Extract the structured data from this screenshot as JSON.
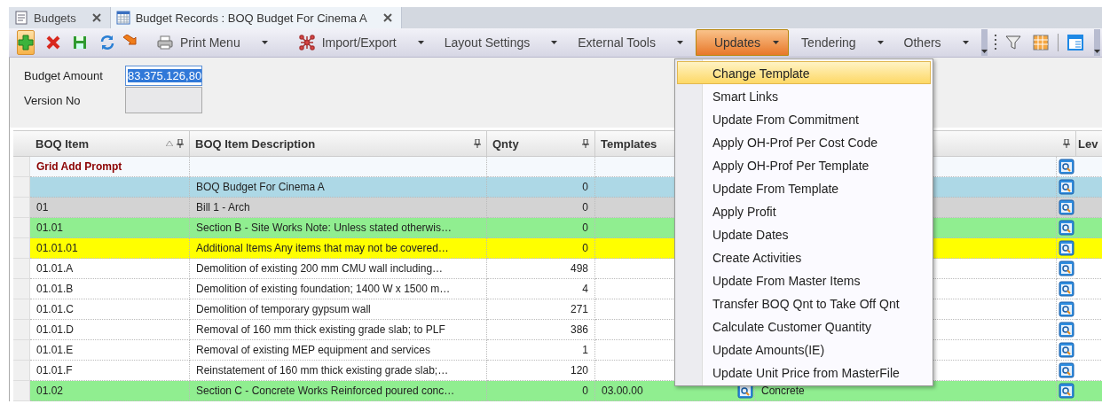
{
  "tabs": [
    {
      "label": "Budgets",
      "selected": false
    },
    {
      "label": "Budget Records : BOQ Budget For Cinema A",
      "selected": true
    }
  ],
  "toolbar": {
    "add_button": {
      "highlighted": true
    },
    "menus": [
      {
        "label": "Print Menu",
        "open": false
      },
      {
        "label": "Import/Export",
        "open": false
      },
      {
        "label": "Layout Settings",
        "open": false
      },
      {
        "label": "External Tools",
        "open": false
      },
      {
        "label": "Updates",
        "open": true
      },
      {
        "label": "Tendering",
        "open": false
      },
      {
        "label": "Others",
        "open": false
      }
    ]
  },
  "form": {
    "fields": [
      {
        "label": "Budget Amount",
        "value": "83.375.126,80",
        "selected": true,
        "disabled": false
      },
      {
        "label": "Version No",
        "selected": false,
        "disabled": true
      }
    ]
  },
  "table": {
    "columns": [
      {
        "label": "BOQ Item",
        "pinned": true,
        "sorted": true
      },
      {
        "label": "BOQ Item Description",
        "pinned": true,
        "sorted": false
      },
      {
        "label": "Qnty",
        "pinned": true,
        "sorted": false
      },
      {
        "label": "Templates"
      },
      {
        "pinned": true,
        "sorted": false
      },
      {
        "label": "Lev"
      }
    ],
    "rows": [
      {
        "kind": "prompt",
        "color": "#f5f9fd",
        "item": "Grid Add Prompt",
        "description": "",
        "qnty": "",
        "templates": "",
        "column_5": ""
      },
      {
        "kind": "data",
        "color": "#add8e6",
        "item": "",
        "description": "BOQ Budget For Cinema A",
        "qnty": "0",
        "templates": "",
        "column_5": ""
      },
      {
        "kind": "data",
        "color": "#d3d3d3",
        "item": "01",
        "description": "Bill 1 - Arch",
        "qnty": "0",
        "templates": "",
        "column_5": ""
      },
      {
        "kind": "data",
        "color": "#90ee90",
        "item": "01.01",
        "description": "Section B - Site Works Note: Unless stated otherwis…",
        "qnty": "0",
        "templates": "",
        "column_5": ""
      },
      {
        "kind": "data",
        "color": "#ffff00",
        "item": "01.01.01",
        "description": "Additional Items Any items that may not be covered…",
        "qnty": "0",
        "templates": "",
        "column_5": ""
      },
      {
        "kind": "data",
        "color": "#ffffff",
        "item": "01.01.A",
        "description": "Demolition of existing 200 mm CMU wall including…",
        "qnty": "498",
        "templates": "",
        "column_5": ""
      },
      {
        "kind": "data",
        "color": "#ffffff",
        "item": "01.01.B",
        "description": "Demolition of existing foundation; 1400 W x 1500 m…",
        "qnty": "4",
        "templates": "",
        "column_5": ""
      },
      {
        "kind": "data",
        "color": "#ffffff",
        "item": "01.01.C",
        "description": "Demolition of temporary gypsum wall",
        "qnty": "271",
        "templates": "",
        "column_5": ""
      },
      {
        "kind": "data",
        "color": "#ffffff",
        "item": "01.01.D",
        "description": "Removal of 160 mm thick existing grade slab; to PLF",
        "qnty": "386",
        "templates": "",
        "column_5": ""
      },
      {
        "kind": "data",
        "color": "#ffffff",
        "item": "01.01.E",
        "description": "Removal of existing MEP equipment and services",
        "qnty": "1",
        "templates": "",
        "column_5": ""
      },
      {
        "kind": "data",
        "color": "#ffffff",
        "item": "01.01.F",
        "description": "Reinstatement of 160 mm thick existing grade slab;…",
        "qnty": "120",
        "templates": "",
        "column_5": ""
      },
      {
        "kind": "data",
        "color": "#90ee90",
        "item": "01.02",
        "description": "Section C - Concrete Works Reinforced poured conc…",
        "qnty": "0",
        "templates": "03.00.00",
        "column_5": "Concrete"
      }
    ]
  },
  "updates_menu": {
    "items": [
      {
        "label": "Change Template",
        "selected": true
      },
      {
        "label": "Smart Links",
        "selected": false
      },
      {
        "label": "Update From Commitment",
        "selected": false
      },
      {
        "label": "Apply OH-Prof Per Cost Code",
        "selected": false
      },
      {
        "label": "Apply OH-Prof Per Template",
        "selected": false
      },
      {
        "label": "Update From Template",
        "selected": false
      },
      {
        "label": "Apply Profit",
        "selected": false
      },
      {
        "label": "Update Dates",
        "selected": false
      },
      {
        "label": "Create Activities",
        "selected": false
      },
      {
        "label": "Update From Master Items",
        "selected": false
      },
      {
        "label": "Transfer BOQ Qnt to Take Off Qnt",
        "selected": false
      },
      {
        "label": "Calculate Customer Quantity",
        "selected": false
      },
      {
        "label": "Update Amounts(IE)",
        "selected": false
      },
      {
        "label": "Update Unit Price from MasterFile",
        "selected": false
      }
    ]
  }
}
